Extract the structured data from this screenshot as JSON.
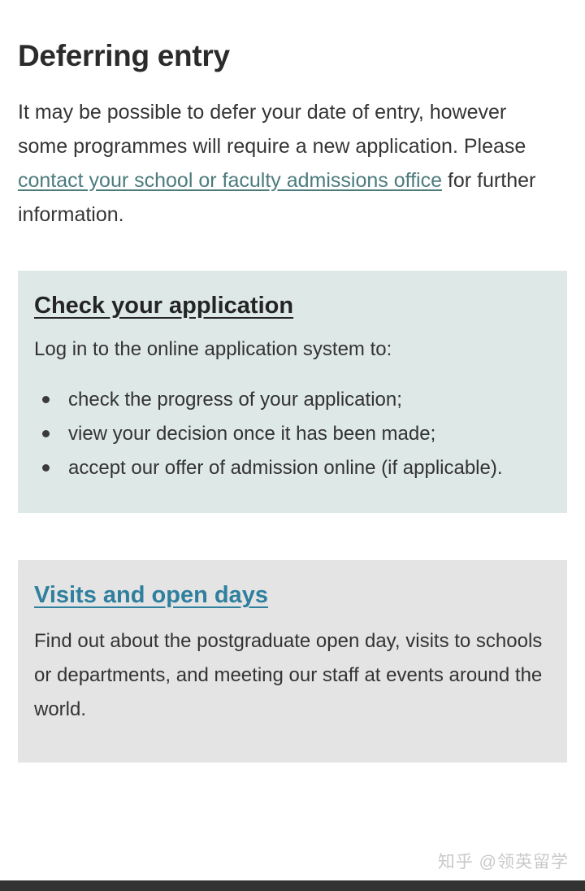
{
  "page": {
    "title": "Deferring entry",
    "intro": {
      "before_link": "It may be possible to defer your date of entry, however some programmes will require a new application. Please ",
      "link_text": "contact your school or faculty admissions office",
      "after_link": " for further information."
    }
  },
  "cards": [
    {
      "id": "check-your-application",
      "heading": "Check your application",
      "lead": "Log in to the online application system to:",
      "bullets": [
        "check the progress of your application;",
        "view your decision once it has been made;",
        "accept our offer of admission online (if applicable)."
      ],
      "background_color": "#dee8e7",
      "heading_color": "#242424"
    },
    {
      "id": "visits-and-open-days",
      "heading": "Visits and open days",
      "body": "Find out about the postgraduate open day, visits to schools or departments, and meeting our staff at events around the world.",
      "background_color": "#e4e4e4",
      "heading_color": "#2f7f9e"
    }
  ],
  "watermark": {
    "text": "知乎 @领英留学"
  },
  "colors": {
    "link": "#4c7b7d",
    "heading_link": "#2f7f9e",
    "body_text": "#333333",
    "title_text": "#2b2b2b",
    "bottom_bar": "#333333"
  }
}
